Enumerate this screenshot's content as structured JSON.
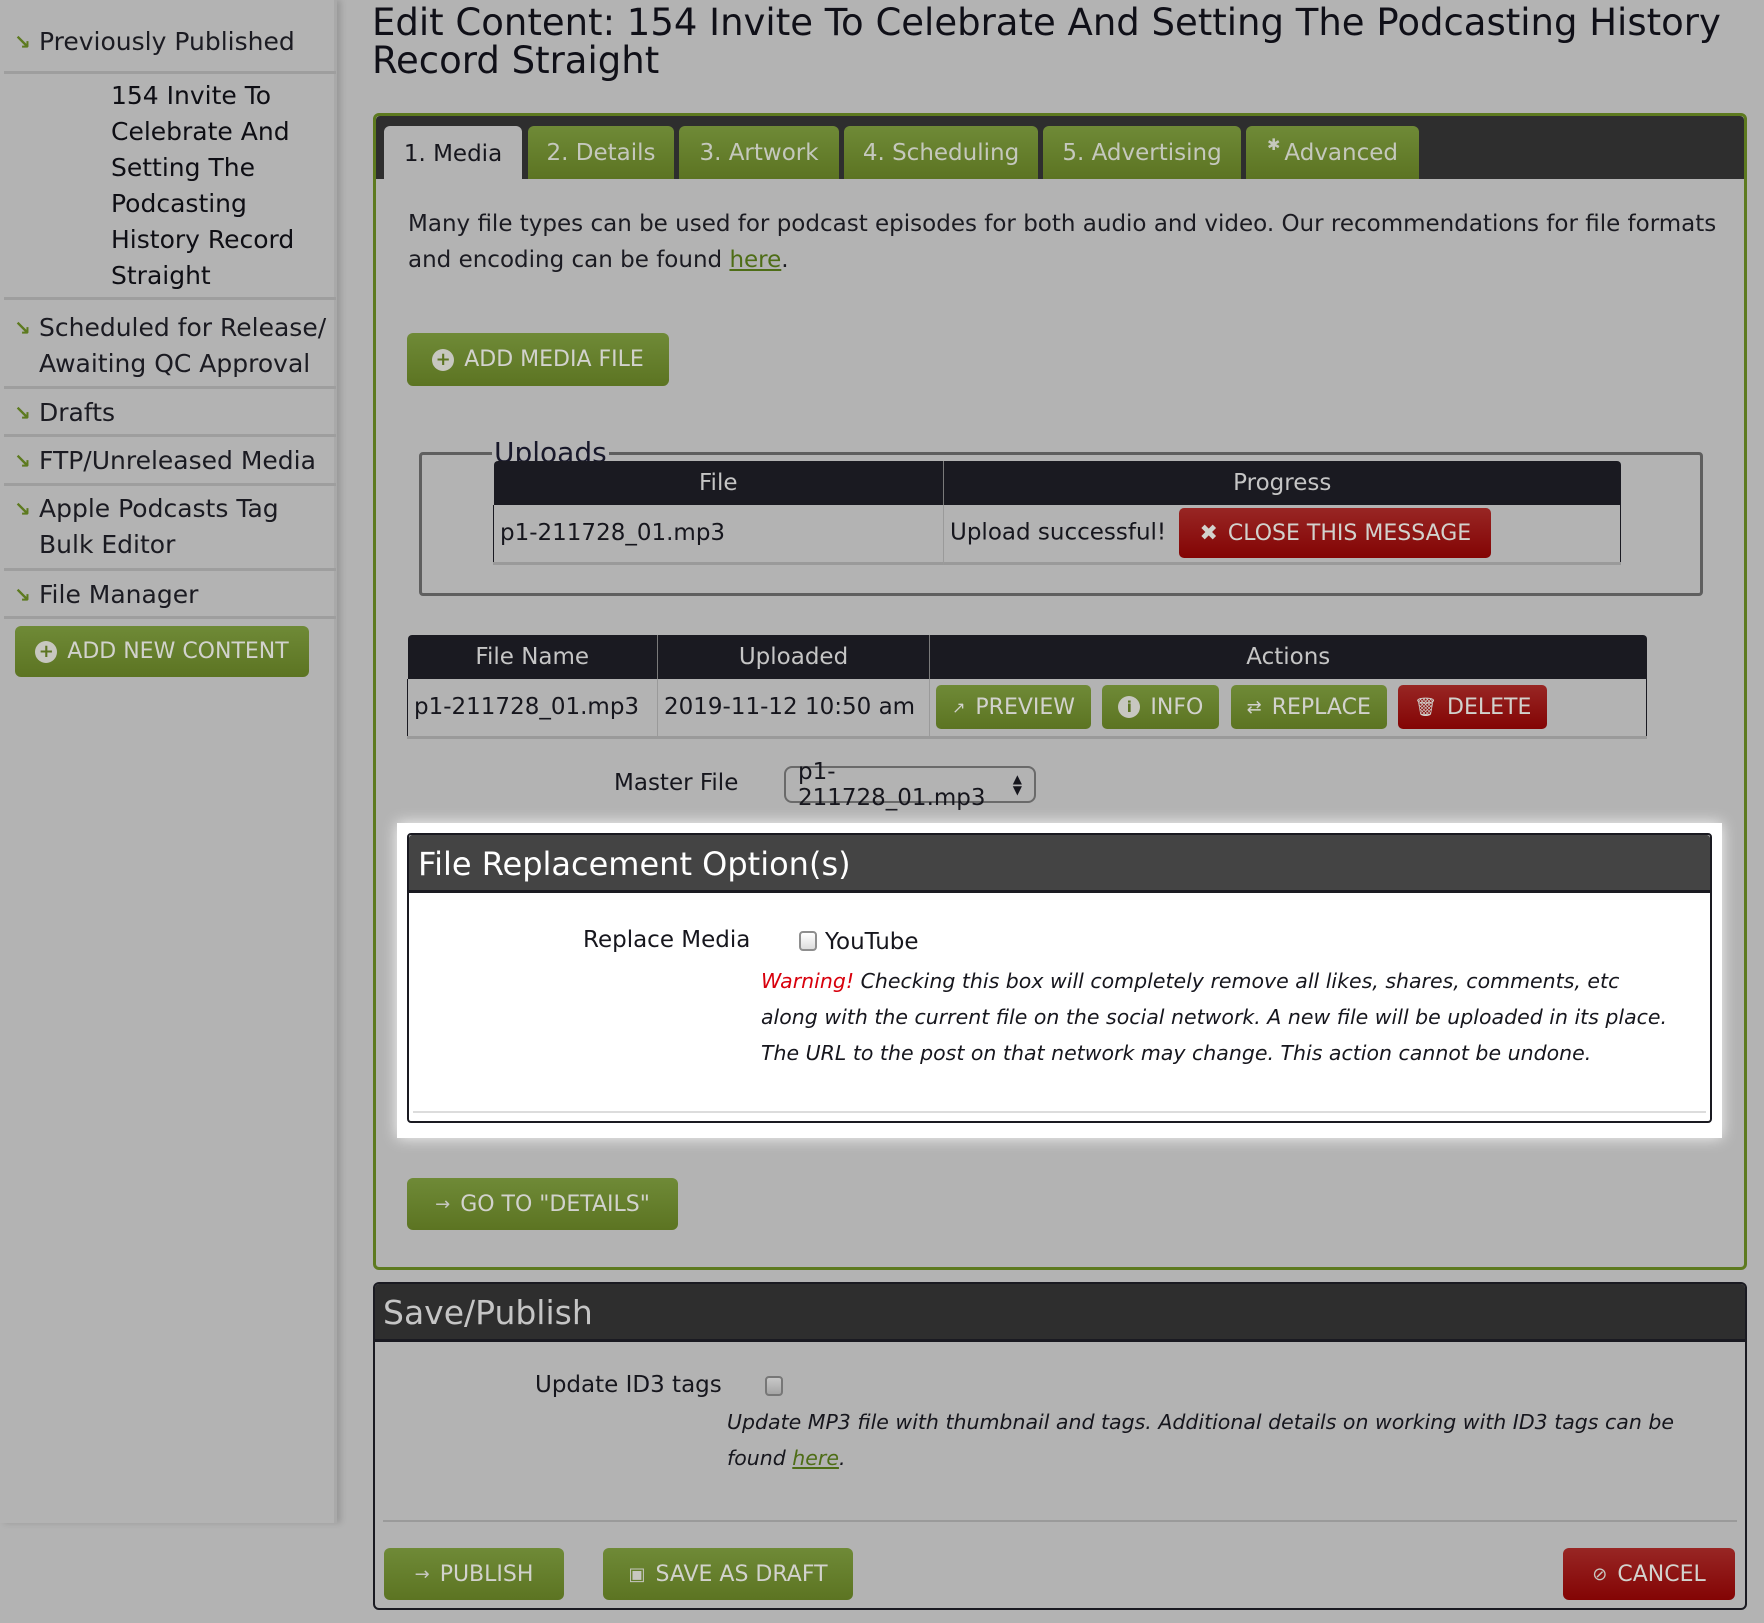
{
  "sidebar": {
    "items": [
      {
        "label": "Previously Published"
      },
      {
        "label": "Scheduled for Release/ Awaiting QC Approval"
      },
      {
        "label": "Drafts"
      },
      {
        "label": "FTP/Unreleased Media"
      },
      {
        "label": "Apple Podcasts Tag Bulk Editor"
      },
      {
        "label": "File Manager"
      }
    ],
    "current_item": "154 Invite To Celebrate And Setting The Podcasting History Record Straight",
    "add_new_label": "ADD NEW CONTENT"
  },
  "page": {
    "title": "Edit Content: 154 Invite To Celebrate And Setting The Podcasting History Record Straight"
  },
  "tabs": [
    {
      "label": "1. Media",
      "active": true
    },
    {
      "label": "2. Details"
    },
    {
      "label": "3. Artwork"
    },
    {
      "label": "4. Scheduling"
    },
    {
      "label": "5. Advertising"
    },
    {
      "label": "Advanced",
      "icon": "gear-icon"
    }
  ],
  "media": {
    "description": "Many file types can be used for podcast episodes for both audio and video. Our recommendations for file formats and encoding can be found ",
    "description_link": "here",
    "description_end": ".",
    "add_media_label": "ADD MEDIA FILE",
    "uploads": {
      "legend": "Uploads",
      "columns": [
        "File",
        "Progress"
      ],
      "rows": [
        {
          "file": "p1-211728_01.mp3",
          "progress": "Upload successful!",
          "close_label": "CLOSE THIS MESSAGE"
        }
      ]
    },
    "files": {
      "columns": [
        "File Name",
        "Uploaded",
        "Actions"
      ],
      "rows": [
        {
          "name": "p1-211728_01.mp3",
          "uploaded": "2019-11-12 10:50 am"
        }
      ],
      "actions": {
        "preview": "PREVIEW",
        "info": "INFO",
        "replace": "REPLACE",
        "delete": "DELETE"
      }
    },
    "master_file": {
      "label": "Master File",
      "value": "p1-211728_01.mp3"
    },
    "replacement": {
      "title": "File Replacement Option(s)",
      "label": "Replace Media",
      "option": "YouTube",
      "checked": false,
      "warning_prefix": "Warning!",
      "warning_text": " Checking this box will completely remove all likes, shares, comments, etc along with the current file on the social network. A new file will be uploaded in its place. The URL to the post on that network may change. This action cannot be undone."
    },
    "go_details_label": "GO TO \"DETAILS\""
  },
  "save_publish": {
    "title": "Save/Publish",
    "id3_label": "Update ID3 tags",
    "id3_checked": false,
    "id3_desc": "Update MP3 file with thumbnail and tags. Additional details on working with ID3 tags can be found ",
    "id3_link": "here",
    "id3_end": ".",
    "publish_label": "PUBLISH",
    "draft_label": "SAVE AS DRAFT",
    "cancel_label": "CANCEL"
  },
  "colors": {
    "accent_green": "#5c7422",
    "danger_red": "#830404",
    "overlay_gray": "#b3b3b3",
    "header_dark": "#2e2e2e",
    "warning_red": "#d8000c"
  }
}
